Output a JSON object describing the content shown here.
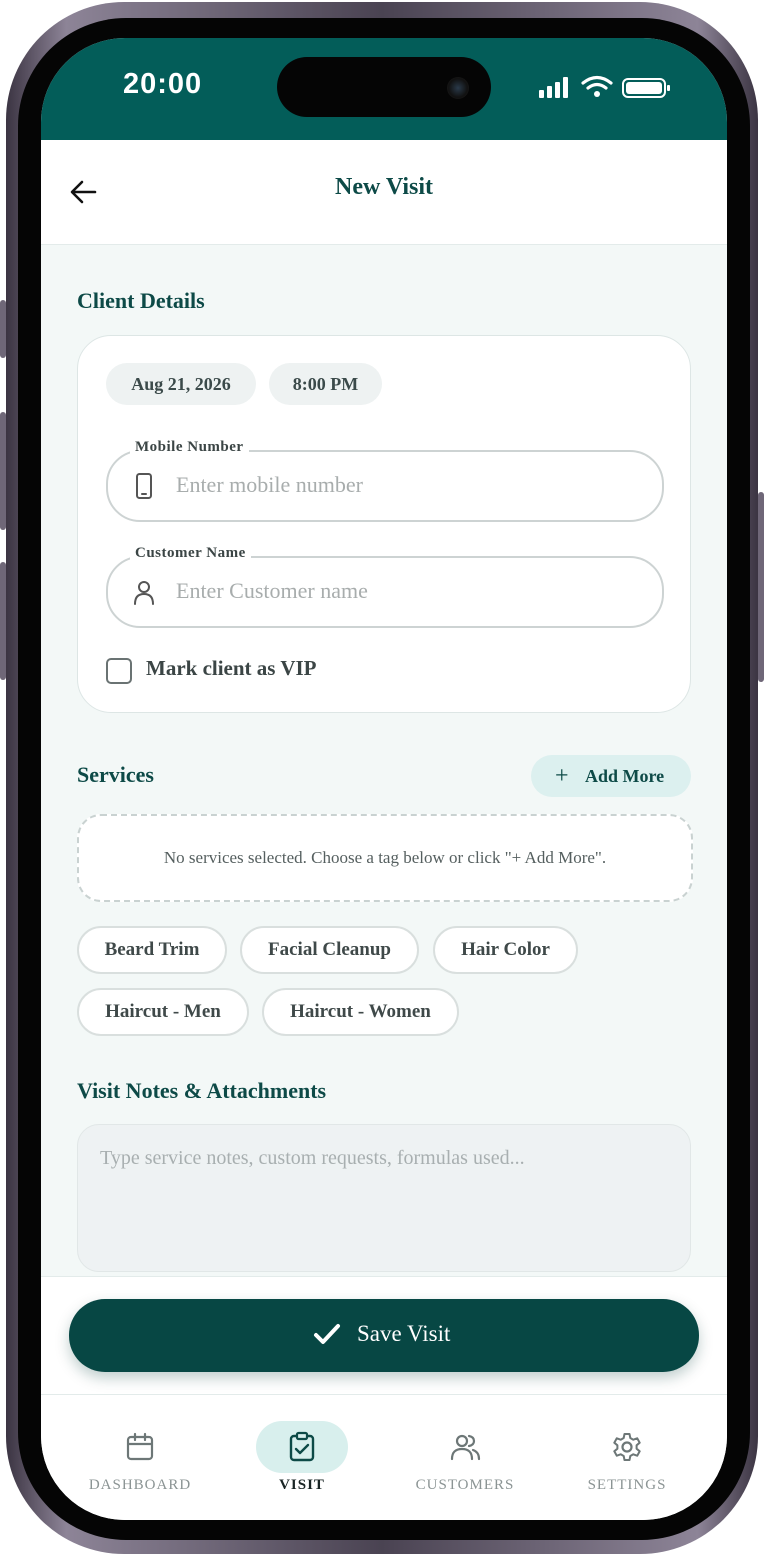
{
  "status_bar": {
    "time": "20:00"
  },
  "header": {
    "title": "New Visit"
  },
  "client_details": {
    "section_title": "Client Details",
    "date": "Aug 21, 2026",
    "time": "8:00 PM",
    "mobile": {
      "label": "Mobile Number",
      "placeholder": "Enter mobile number",
      "value": ""
    },
    "customer": {
      "label": "Customer Name",
      "placeholder": "Enter Customer name",
      "value": ""
    },
    "vip_label": "Mark client as VIP",
    "vip_checked": false
  },
  "services": {
    "section_title": "Services",
    "add_more_label": "Add More",
    "empty_message": "No services selected. Choose a tag below or click \"+ Add More\".",
    "tags": [
      "Beard Trim",
      "Facial Cleanup",
      "Hair Color",
      "Haircut - Men",
      "Haircut - Women"
    ]
  },
  "notes": {
    "section_title": "Visit Notes & Attachments",
    "placeholder": "Type service notes, custom requests, formulas used..."
  },
  "save_label": "Save Visit",
  "tabs": [
    {
      "label": "DASHBOARD",
      "icon": "calendar-icon",
      "active": false
    },
    {
      "label": "VISIT",
      "icon": "clipboard-check-icon",
      "active": true
    },
    {
      "label": "CUSTOMERS",
      "icon": "users-icon",
      "active": false
    },
    {
      "label": "SETTINGS",
      "icon": "gear-icon",
      "active": false
    }
  ],
  "colors": {
    "brand": "#035d59",
    "primary_button": "#074744",
    "accent_soft": "#dcf0ef",
    "title_text": "#0d4a47",
    "background": "#f3f8f7"
  }
}
